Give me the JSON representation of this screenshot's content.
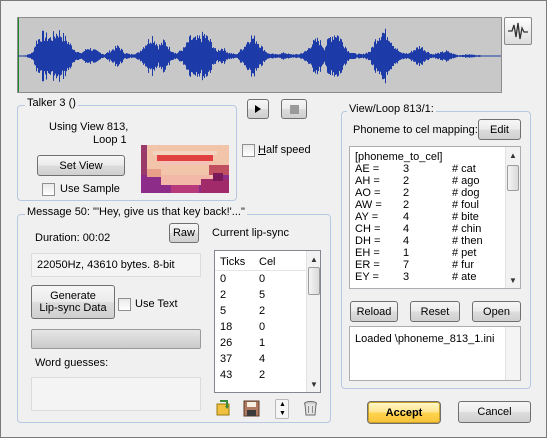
{
  "waveform": {
    "color": "#1c3aa8",
    "background": "#c8c8c8"
  },
  "talker": {
    "group_label": "Talker 3 ()",
    "using_view": "Using View 813,",
    "loop": "Loop 1",
    "set_view_label": "Set View",
    "use_sample_label": "Use Sample"
  },
  "playback": {
    "play_icon": "play-icon",
    "stop_icon": "stop-icon",
    "half_speed_label": "Half speed"
  },
  "message": {
    "group_label": "Message 50: \"'Hey, give us that key back!'...\"",
    "duration": "Duration: 00:02",
    "raw_label": "Raw",
    "current_lipsync_label": "Current lip-sync",
    "audio_info": "22050Hz, 43610 bytes. 8-bit",
    "generate_label_line1": "Generate",
    "generate_label_line2": "Lip-sync Data",
    "use_text_label": "Use Text",
    "progress": 0,
    "word_guesses_label": "Word guesses:",
    "word_guesses_value": ""
  },
  "lipsync_table": {
    "headers": [
      "Ticks",
      "Cel"
    ],
    "rows": [
      [
        "0",
        "0"
      ],
      [
        "2",
        "5"
      ],
      [
        "5",
        "2"
      ],
      [
        "18",
        "0"
      ],
      [
        "26",
        "1"
      ],
      [
        "37",
        "4"
      ],
      [
        "43",
        "2"
      ]
    ],
    "toolbar_icons": [
      "insert-icon",
      "save-icon",
      "spin-icon",
      "delete-icon"
    ]
  },
  "view_loop": {
    "group_label": "View/Loop 813/1:",
    "mapping_label": "Phoneme to cel mapping:",
    "edit_label": "Edit",
    "section_header": "[phoneme_to_cel]",
    "mappings": [
      {
        "phoneme": "AE =",
        "cel": "3",
        "comment": "# cat"
      },
      {
        "phoneme": "AH =",
        "cel": "2",
        "comment": "# ago"
      },
      {
        "phoneme": "AO =",
        "cel": "2",
        "comment": "# dog"
      },
      {
        "phoneme": "AW =",
        "cel": "2",
        "comment": "# foul"
      },
      {
        "phoneme": "AY =",
        "cel": "4",
        "comment": "# bite"
      },
      {
        "phoneme": "CH =",
        "cel": "4",
        "comment": "# chin"
      },
      {
        "phoneme": "DH =",
        "cel": "4",
        "comment": "# then"
      },
      {
        "phoneme": "EH =",
        "cel": "1",
        "comment": "# pet"
      },
      {
        "phoneme": "ER =",
        "cel": "7",
        "comment": "# fur"
      },
      {
        "phoneme": "EY =",
        "cel": "3",
        "comment": "# ate"
      }
    ],
    "reload_label": "Reload",
    "reset_label": "Reset",
    "open_label": "Open",
    "status_text": "Loaded \\phoneme_813_1.ini"
  },
  "footer": {
    "accept_label": "Accept",
    "cancel_label": "Cancel"
  }
}
